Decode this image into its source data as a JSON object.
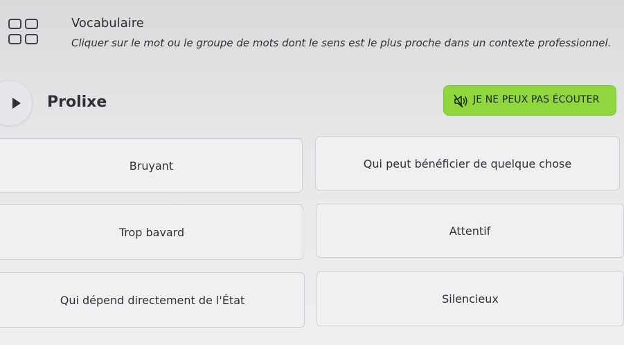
{
  "header": {
    "title": "Vocabulaire",
    "instruction": "Cliquer sur le mot ou le groupe de mots dont le sens est le plus proche dans un contexte professionnel."
  },
  "question": {
    "word": "Prolixe",
    "play_icon": "play-icon",
    "listen_button_label": "JE NE PEUX PAS ÉCOUTER",
    "listen_icon": "speaker-muted-icon"
  },
  "answers": [
    "Bruyant",
    "Qui peut bénéficier de quelque chose",
    "Trop bavard",
    "Attentif",
    "Qui dépend directement de l'État",
    "Silencieux"
  ],
  "colors": {
    "accent_green": "#8fd63f",
    "text": "#2f3033"
  }
}
